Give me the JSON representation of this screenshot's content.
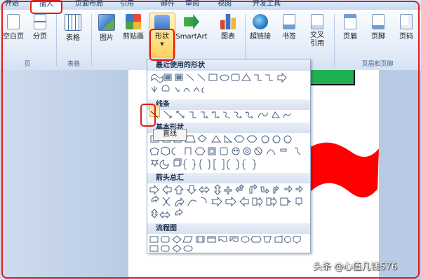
{
  "tabs": [
    "开始",
    "插入",
    "页面布局",
    "引用",
    "邮件",
    "审阅",
    "视图",
    "开发工具"
  ],
  "ribbon": {
    "buttons": [
      "空白页",
      "分页",
      "表格",
      "图片",
      "剪贴画",
      "形状",
      "SmartArt",
      "图表",
      "超链接",
      "书签",
      "交叉引用",
      "页眉",
      "页脚",
      "页码"
    ],
    "groups": [
      "页",
      "表格",
      "页眉和页脚"
    ]
  },
  "shapes_menu": {
    "sections": [
      "最近使用的形状",
      "线条",
      "基本形状",
      "箭头总汇",
      "流程图"
    ],
    "tooltip": "直线"
  },
  "watermark": "头条 @心值几钱576",
  "colors": {
    "callout": "#e61919",
    "green_shape": "#1fb04f",
    "red_flag": "#ff0000",
    "highlight": "#fde9a8"
  }
}
